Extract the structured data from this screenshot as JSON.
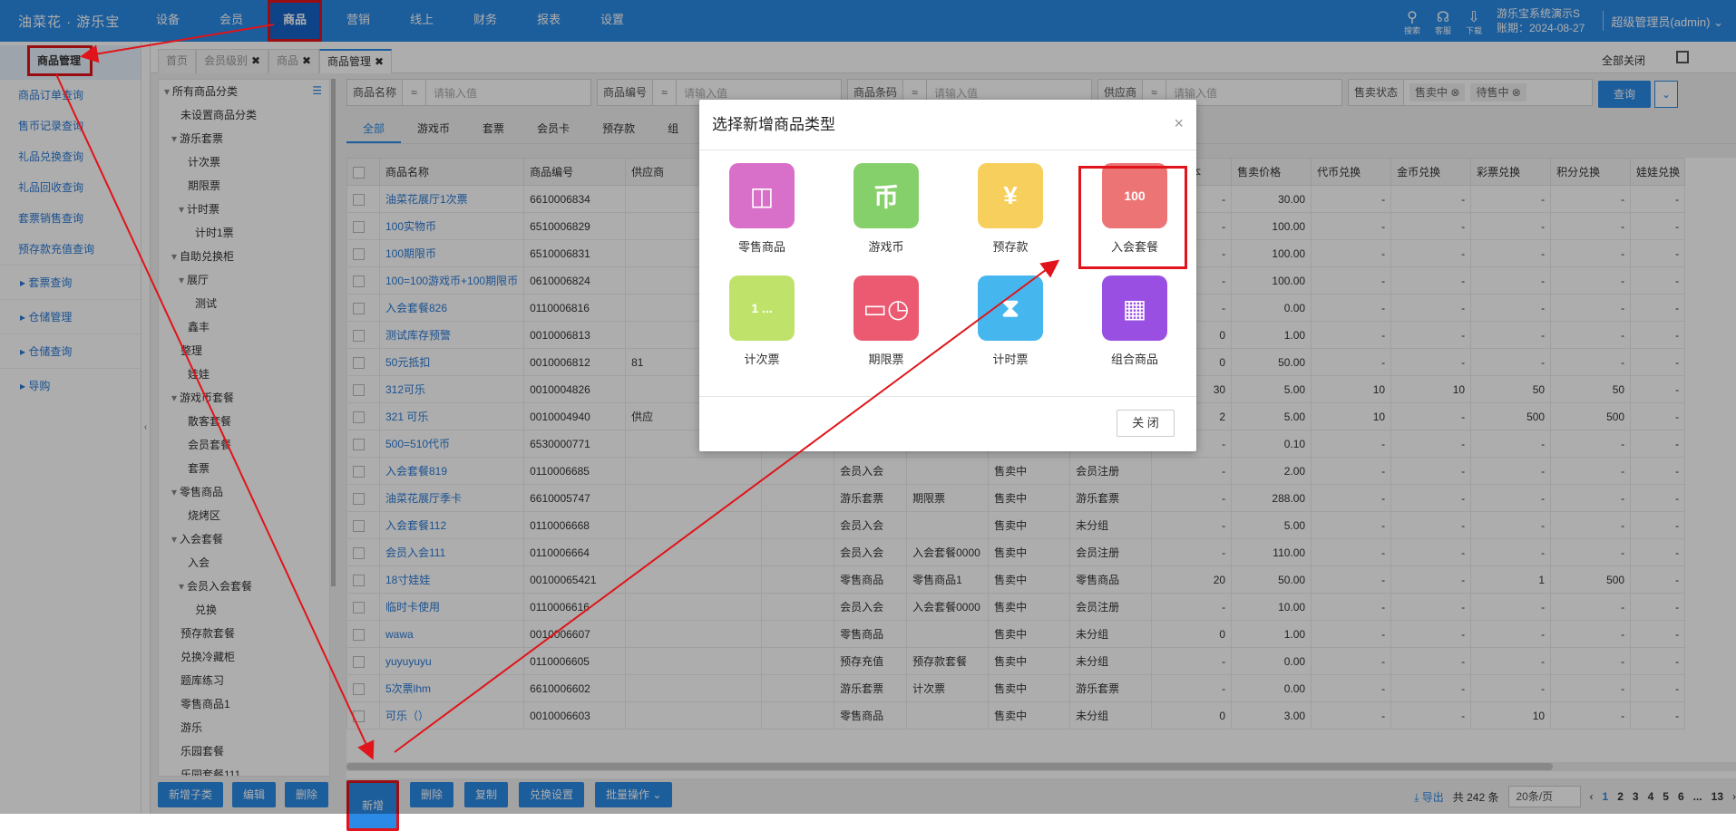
{
  "app": {
    "logo": "油菜花 · 游乐宝"
  },
  "topnav": [
    "设备",
    "会员",
    "商品",
    "营销",
    "线上",
    "财务",
    "报表",
    "设置"
  ],
  "topnav_active": "商品",
  "tools": [
    {
      "icon": "search-icon",
      "label": "搜索"
    },
    {
      "icon": "headset-icon",
      "label": "客服"
    },
    {
      "icon": "download-icon",
      "label": "下载"
    }
  ],
  "sysinfo": {
    "name": "游乐宝系统演示S",
    "date": "账期：2024-08-27"
  },
  "admin": "超级管理员(admin)",
  "sidebar": {
    "items": [
      "商品管理",
      "商品订单查询",
      "售币记录查询",
      "礼品兑换查询",
      "礼品回收查询",
      "套票销售查询",
      "预存款充值查询"
    ],
    "groups": [
      "套票查询",
      "仓储管理",
      "仓储查询",
      "导购"
    ]
  },
  "tabs": [
    {
      "label": "首页",
      "close": ""
    },
    {
      "label": "会员级别",
      "close": "✖"
    },
    {
      "label": "商品",
      "close": "✖"
    },
    {
      "label": "商品管理",
      "close": "✖"
    }
  ],
  "closeall": "全部关闭",
  "tree": [
    {
      "text": "所有商品分类",
      "level": 0,
      "arrow": "▾"
    },
    {
      "text": "未设置商品分类",
      "level": 1,
      "arrow": ""
    },
    {
      "text": "游乐套票",
      "level": 1,
      "arrow": "▾"
    },
    {
      "text": "计次票",
      "level": 2,
      "arrow": ""
    },
    {
      "text": "期限票",
      "level": 2,
      "arrow": ""
    },
    {
      "text": "计时票",
      "level": 2,
      "arrow": "▾"
    },
    {
      "text": "计时1票",
      "level": 3,
      "arrow": ""
    },
    {
      "text": "自助兑换柜",
      "level": 1,
      "arrow": "▾"
    },
    {
      "text": "展厅",
      "level": 2,
      "arrow": "▾"
    },
    {
      "text": "测试",
      "level": 3,
      "arrow": ""
    },
    {
      "text": "鑫丰",
      "level": 2,
      "arrow": ""
    },
    {
      "text": "整理",
      "level": 1,
      "arrow": ""
    },
    {
      "text": "娃娃",
      "level": 2,
      "arrow": ""
    },
    {
      "text": "游戏币套餐",
      "level": 1,
      "arrow": "▾"
    },
    {
      "text": "散客套餐",
      "level": 2,
      "arrow": ""
    },
    {
      "text": "会员套餐",
      "level": 2,
      "arrow": ""
    },
    {
      "text": "套票",
      "level": 2,
      "arrow": ""
    },
    {
      "text": "零售商品",
      "level": 1,
      "arrow": "▾"
    },
    {
      "text": "烧烤区",
      "level": 2,
      "arrow": ""
    },
    {
      "text": "入会套餐",
      "level": 1,
      "arrow": "▾"
    },
    {
      "text": "入会",
      "level": 2,
      "arrow": ""
    },
    {
      "text": "会员入会套餐",
      "level": 2,
      "arrow": "▾"
    },
    {
      "text": "兑换",
      "level": 3,
      "arrow": ""
    },
    {
      "text": "预存款套餐",
      "level": 1,
      "arrow": ""
    },
    {
      "text": "兑换冷藏柜",
      "level": 1,
      "arrow": ""
    },
    {
      "text": "题库练习",
      "level": 1,
      "arrow": ""
    },
    {
      "text": "零售商品1",
      "level": 1,
      "arrow": ""
    },
    {
      "text": "游乐",
      "level": 1,
      "arrow": ""
    },
    {
      "text": "乐园套餐",
      "level": 1,
      "arrow": ""
    },
    {
      "text": "乐园套餐111",
      "level": 1,
      "arrow": ""
    }
  ],
  "tree_buttons": [
    "新增子类",
    "编辑",
    "删除"
  ],
  "filters": [
    {
      "label": "商品名称",
      "op": "≈",
      "placeholder": "请输入值"
    },
    {
      "label": "商品编号",
      "op": "≈",
      "placeholder": "请输入值"
    },
    {
      "label": "商品条码",
      "op": "≈",
      "placeholder": "请输入值"
    },
    {
      "label": "供应商",
      "op": "≈",
      "placeholder": "请输入值"
    }
  ],
  "status_filter": {
    "label": "售卖状态",
    "chips": [
      "售卖中",
      "待售中"
    ]
  },
  "query_label": "查询",
  "subtabs": [
    "全部",
    "游戏币",
    "套票",
    "会员卡",
    "预存款",
    "组"
  ],
  "columns": [
    "商品名称",
    "商品编号",
    "供应商",
    "",
    "",
    "",
    "",
    "",
    "估算成本",
    "售卖价格",
    "代币兑换",
    "金币兑换",
    "彩票兑换",
    "积分兑换",
    "娃娃兑换"
  ],
  "rows": [
    [
      "油菜花展厅1次票",
      "6610006834",
      "",
      "",
      "",
      "",
      "",
      "",
      "-",
      "30.00",
      "-",
      "-",
      "-",
      "-",
      "-"
    ],
    [
      "100实物币",
      "6510006829",
      "",
      "",
      "",
      "",
      "",
      "",
      "-",
      "100.00",
      "-",
      "-",
      "-",
      "-",
      "-"
    ],
    [
      "100期限币",
      "6510006831",
      "",
      "",
      "",
      "",
      "",
      "",
      "-",
      "100.00",
      "-",
      "-",
      "-",
      "-",
      "-"
    ],
    [
      "100=100游戏币+100期限币",
      "0610006824",
      "",
      "",
      "",
      "",
      "",
      "",
      "-",
      "100.00",
      "-",
      "-",
      "-",
      "-",
      "-"
    ],
    [
      "入会套餐826",
      "0110006816",
      "",
      "",
      "",
      "",
      "",
      "",
      "-",
      "0.00",
      "-",
      "-",
      "-",
      "-",
      "-"
    ],
    [
      "测试库存预警",
      "0010006813",
      "",
      "",
      "",
      "",
      "",
      "",
      "0",
      "1.00",
      "-",
      "-",
      "-",
      "-",
      "-"
    ],
    [
      "50元抵扣",
      "0010006812",
      "81",
      "",
      "",
      "",
      "",
      "",
      "0",
      "50.00",
      "-",
      "-",
      "-",
      "-",
      "-"
    ],
    [
      "312可乐",
      "0010004826",
      "",
      "",
      "",
      "",
      "",
      "",
      "30",
      "5.00",
      "10",
      "10",
      "50",
      "50",
      "-"
    ],
    [
      "321 可乐",
      "0010004940",
      "供应",
      "",
      "",
      "",
      "",
      "",
      "2",
      "5.00",
      "10",
      "-",
      "500",
      "500",
      "-"
    ],
    [
      "500=510代币",
      "6530000771",
      "",
      "",
      "",
      "",
      "",
      "",
      "-",
      "0.10",
      "-",
      "-",
      "-",
      "-",
      "-"
    ],
    [
      "入会套餐819",
      "0110006685",
      "",
      "",
      "会员入会",
      "",
      "售卖中",
      "会员注册",
      "-",
      "2.00",
      "-",
      "-",
      "-",
      "-",
      "-"
    ],
    [
      "油菜花展厅季卡",
      "6610005747",
      "",
      "",
      "游乐套票",
      "期限票",
      "售卖中",
      "游乐套票",
      "-",
      "288.00",
      "-",
      "-",
      "-",
      "-",
      "-"
    ],
    [
      "入会套餐112",
      "0110006668",
      "",
      "",
      "会员入会",
      "",
      "售卖中",
      "未分组",
      "-",
      "5.00",
      "-",
      "-",
      "-",
      "-",
      "-"
    ],
    [
      "会员入会111",
      "0110006664",
      "",
      "",
      "会员入会",
      "入会套餐0000",
      "售卖中",
      "会员注册",
      "-",
      "110.00",
      "-",
      "-",
      "-",
      "-",
      "-"
    ],
    [
      "18寸娃娃",
      "00100065421",
      "",
      "",
      "零售商品",
      "零售商品1",
      "售卖中",
      "零售商品",
      "20",
      "50.00",
      "-",
      "-",
      "1",
      "500",
      "-"
    ],
    [
      "临时卡使用",
      "0110006616",
      "",
      "",
      "会员入会",
      "入会套餐0000",
      "售卖中",
      "会员注册",
      "-",
      "10.00",
      "-",
      "-",
      "-",
      "-",
      "-"
    ],
    [
      "wawa",
      "0010006607",
      "",
      "",
      "零售商品",
      "",
      "售卖中",
      "未分组",
      "0",
      "1.00",
      "-",
      "-",
      "-",
      "-",
      "-"
    ],
    [
      "yuyuyuyu",
      "0110006605",
      "",
      "",
      "预存充值",
      "预存款套餐",
      "售卖中",
      "未分组",
      "-",
      "0.00",
      "-",
      "-",
      "-",
      "-",
      "-"
    ],
    [
      "5次票lhm",
      "6610006602",
      "",
      "",
      "游乐套票",
      "计次票",
      "售卖中",
      "游乐套票",
      "-",
      "0.00",
      "-",
      "-",
      "-",
      "-",
      "-"
    ],
    [
      "可乐（）",
      "0010006603",
      "",
      "",
      "零售商品",
      "",
      "售卖中",
      "未分组",
      "0",
      "3.00",
      "-",
      "-",
      "10",
      "-",
      "-"
    ]
  ],
  "op_buttons": [
    "新增",
    "删除",
    "复制",
    "兑换设置",
    "批量操作 ⌄"
  ],
  "pager": {
    "export": "导出",
    "total": "共 242 条",
    "size": "20条/页",
    "pages": [
      "1",
      "2",
      "3",
      "4",
      "5",
      "6",
      "...",
      "13"
    ]
  },
  "modal": {
    "title": "选择新增商品类型",
    "close_btn": "关 闭",
    "items": [
      {
        "label": "零售商品",
        "icon": "bag-icon",
        "color": "#d86fc9"
      },
      {
        "label": "游戏币",
        "icon": "coin-icon",
        "color": "#86d06b"
      },
      {
        "label": "预存款",
        "icon": "yuan-icon",
        "color": "#f7cf5c"
      },
      {
        "label": "入会套餐",
        "icon": "card-100-icon",
        "color": "#ec7475"
      },
      {
        "label": "计次票",
        "icon": "ticket-icon",
        "color": "#bfe36a"
      },
      {
        "label": "期限票",
        "icon": "clock-card-icon",
        "color": "#ec5a72"
      },
      {
        "label": "计时票",
        "icon": "hourglass-icon",
        "color": "#45b7ee"
      },
      {
        "label": "组合商品",
        "icon": "grid-icon",
        "color": "#9a4fe3"
      }
    ]
  }
}
